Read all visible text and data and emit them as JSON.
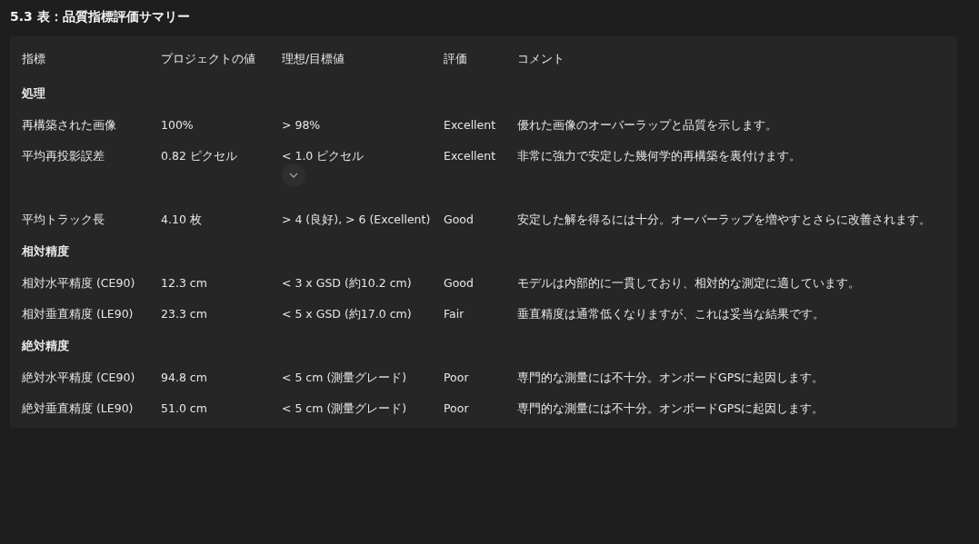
{
  "title": "5.3 表：品質指標評価サマリー",
  "columns": [
    "指標",
    "プロジェクトの値",
    "理想/目標値",
    "評価",
    "コメント"
  ],
  "sections": [
    {
      "title": "処理",
      "rows": [
        {
          "metric": "再構築された画像",
          "value": "100%",
          "target": "> 98%",
          "rating": "Excellent",
          "comment": "優れた画像のオーバーラップと品質を示します。"
        },
        {
          "metric": "平均再投影誤差",
          "value": "0.82 ピクセル",
          "target": "< 1.0 ピクセル",
          "target_menu": true,
          "rating": "Excellent",
          "comment": "非常に強力で安定した幾何学的再構築を裏付けます。"
        },
        {
          "metric": "平均トラック長",
          "value": "4.10 枚",
          "target": "> 4 (良好), > 6 (Excellent)",
          "rating": "Good",
          "comment": "安定した解を得るには十分。オーバーラップを増やすとさらに改善されます。"
        }
      ]
    },
    {
      "title": "相対精度",
      "rows": [
        {
          "metric": "相対水平精度 (CE90)",
          "value": "12.3 cm",
          "target": "< 3 x GSD (約10.2 cm)",
          "rating": "Good",
          "comment": "モデルは内部的に一貫しており、相対的な測定に適しています。"
        },
        {
          "metric": "相対垂直精度 (LE90)",
          "value": "23.3 cm",
          "target": "< 5 x GSD (約17.0 cm)",
          "rating": "Fair",
          "comment": "垂直精度は通常低くなりますが、これは妥当な結果です。"
        }
      ]
    },
    {
      "title": "絶対精度",
      "rows": [
        {
          "metric": "絶対水平精度 (CE90)",
          "value": "94.8 cm",
          "target": "< 5 cm (測量グレード)",
          "rating": "Poor",
          "comment": "専門的な測量には不十分。オンボードGPSに起因します。"
        },
        {
          "metric": "絶対垂直精度 (LE90)",
          "value": "51.0 cm",
          "target": "< 5 cm (測量グレード)",
          "rating": "Poor",
          "comment": "専門的な測量には不十分。オンボードGPSに起因します。"
        }
      ]
    }
  ]
}
